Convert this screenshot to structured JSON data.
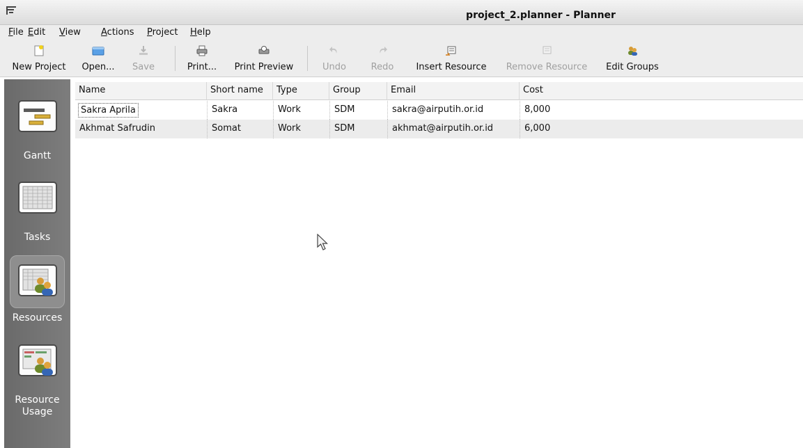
{
  "window": {
    "title": "project_2.planner - Planner"
  },
  "menubar": [
    {
      "key": "F",
      "rest": "ile"
    },
    {
      "key": "E",
      "rest": "dit"
    },
    {
      "key": "V",
      "rest": "iew"
    },
    {
      "key": "A",
      "rest": "ctions"
    },
    {
      "key": "P",
      "rest": "roject"
    },
    {
      "key": "H",
      "rest": "elp"
    }
  ],
  "toolbar": {
    "new_project": "New Project",
    "open": "Open...",
    "save": "Save",
    "print": "Print...",
    "print_preview": "Print Preview",
    "undo": "Undo",
    "redo": "Redo",
    "insert_resource": "Insert Resource",
    "remove_resource": "Remove Resource",
    "edit_groups": "Edit Groups"
  },
  "sidebar": {
    "gantt": "Gantt",
    "tasks": "Tasks",
    "resources": "Resources",
    "resource_usage_1": "Resource",
    "resource_usage_2": "Usage"
  },
  "table": {
    "columns": [
      "Name",
      "Short name",
      "Type",
      "Group",
      "Email",
      "Cost"
    ],
    "rows": [
      [
        "Sakra Aprila",
        "Sakra",
        "Work",
        "SDM",
        "sakra@airputih.or.id",
        "8,000"
      ],
      [
        "Akhmat Safrudin",
        "Somat",
        "Work",
        "SDM",
        "akhmat@airputih.or.id",
        "6,000"
      ]
    ]
  },
  "colors": {
    "sidebar": "#747474",
    "row_alt": "#ececec",
    "toolbar": "#ededed"
  }
}
